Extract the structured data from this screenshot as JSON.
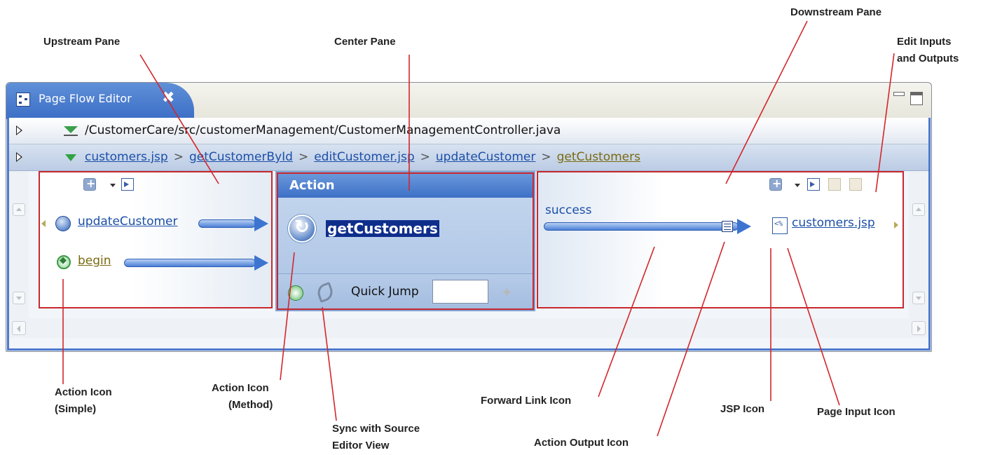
{
  "callouts": {
    "upstream": "Upstream Pane",
    "center": "Center Pane",
    "downstream": "Downstream Pane",
    "edit_io_line1": "Edit Inputs",
    "edit_io_line2": "and Outputs",
    "action_simple_line1": "Action Icon",
    "action_simple_line2": "(Simple)",
    "action_method_line1": "Action Icon",
    "action_method_line2": "(Method)",
    "sync_line1": "Sync with Source",
    "sync_line2": "Editor View",
    "forward_link": "Forward Link Icon",
    "action_output": "Action Output Icon",
    "jsp_icon": "JSP Icon",
    "page_input": "Page Input Icon"
  },
  "editor": {
    "tab_title": "Page Flow Editor",
    "tab_close": "✖",
    "file_path": "/CustomerCare/src/customerManagement/CustomerManagementController.java",
    "breadcrumbs": [
      {
        "label": "customers.jsp"
      },
      {
        "label": "getCustomerById"
      },
      {
        "label": "editCustomer.jsp"
      },
      {
        "label": "updateCustomer"
      },
      {
        "label": "getCustomers"
      }
    ],
    "breadcrumb_sep": ">"
  },
  "upstream": {
    "items": [
      {
        "label": "updateCustomer"
      },
      {
        "label": "begin"
      }
    ]
  },
  "center": {
    "header": "Action",
    "method_name": "getCustomers",
    "quick_jump_label": "Quick Jump",
    "quick_jump_value": ""
  },
  "downstream": {
    "forward_label": "success",
    "target": "customers.jsp"
  },
  "colors": {
    "accent": "#3d70c7",
    "highlight_border": "#c8282e"
  }
}
